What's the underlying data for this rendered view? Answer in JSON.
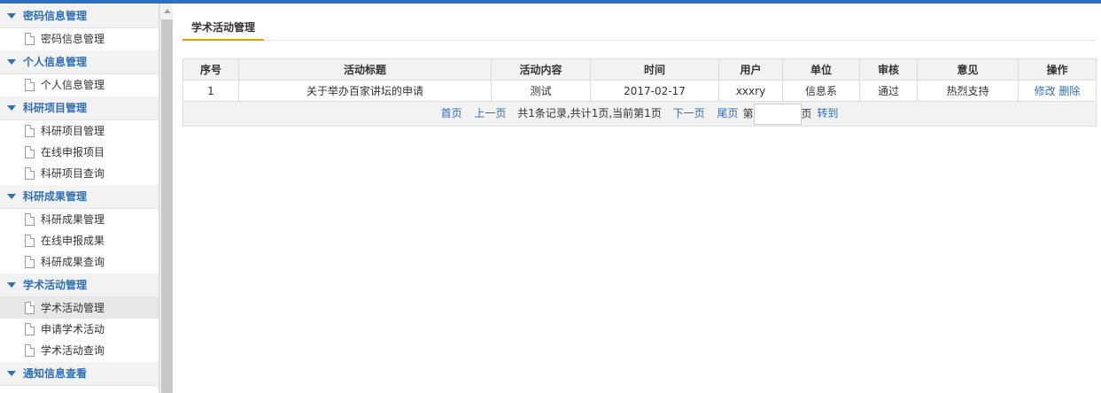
{
  "sidebar": {
    "groups": [
      {
        "title": "密码信息管理",
        "items": [
          "密码信息管理"
        ]
      },
      {
        "title": "个人信息管理",
        "items": [
          "个人信息管理"
        ]
      },
      {
        "title": "科研项目管理",
        "items": [
          "科研项目管理",
          "在线申报项目",
          "科研项目查询"
        ]
      },
      {
        "title": "科研成果管理",
        "items": [
          "科研成果管理",
          "在线申报成果",
          "科研成果查询"
        ]
      },
      {
        "title": "学术活动管理",
        "items": [
          "学术活动管理",
          "申请学术活动",
          "学术活动查询"
        ]
      },
      {
        "title": "通知信息查看",
        "items": []
      }
    ]
  },
  "main": {
    "tab_label": "学术活动管理",
    "table": {
      "headers": [
        "序号",
        "活动标题",
        "活动内容",
        "时间",
        "用户",
        "单位",
        "审核",
        "意见",
        "操作"
      ],
      "rows": [
        {
          "no": "1",
          "title": "关于举办百家讲坛的申请",
          "content": "测试",
          "time": "2017-02-17",
          "user": "xxxry",
          "unit": "信息系",
          "review": "通过",
          "opinion": "热烈支持",
          "edit": "修改",
          "delete": "删除"
        }
      ]
    },
    "pager": {
      "first": "首页",
      "prev": "上一页",
      "summary": "共1条记录,共计1页,当前第1页",
      "next": "下一页",
      "last": "尾页",
      "page_prefix": "第",
      "page_suffix": "页",
      "page_value": "",
      "go": "转到"
    }
  }
}
